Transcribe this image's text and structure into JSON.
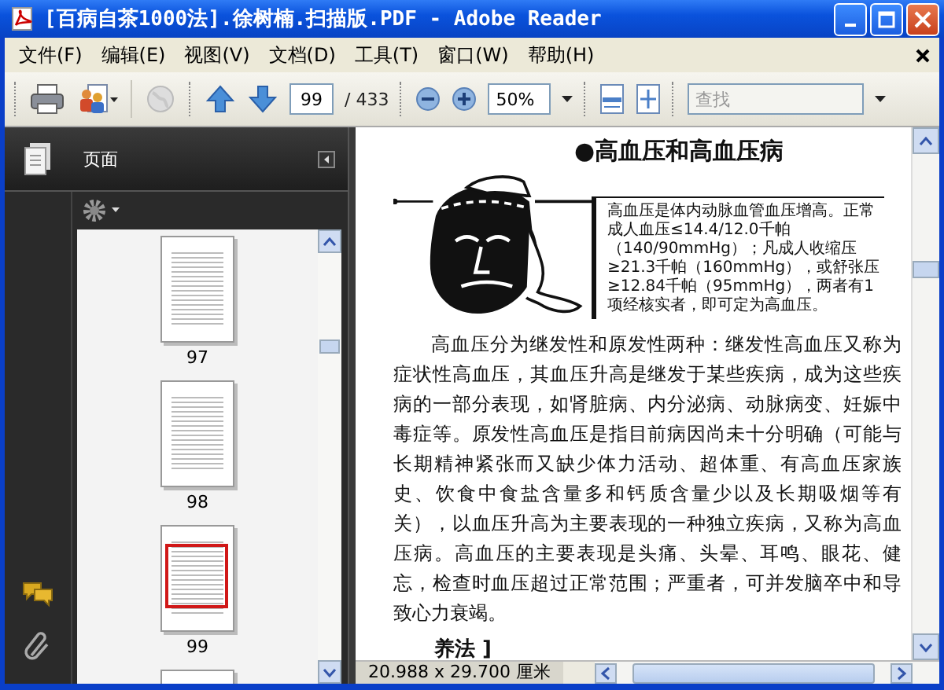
{
  "window": {
    "title": "[百病自茶1000法].徐树楠.扫描版.PDF - Adobe Reader"
  },
  "menu": [
    "文件(F)",
    "编辑(E)",
    "视图(V)",
    "文档(D)",
    "工具(T)",
    "窗口(W)",
    "帮助(H)"
  ],
  "toolbar": {
    "page_number": "99",
    "page_total": "/ 433",
    "zoom": "50%",
    "search": {
      "placeholder": "查找"
    }
  },
  "nav_panel": {
    "title": "页面",
    "thumbnails": [
      {
        "label": "97",
        "selected": false
      },
      {
        "label": "98",
        "selected": false
      },
      {
        "label": "99",
        "selected": true
      }
    ]
  },
  "document": {
    "heading": "●高血压和高血压病",
    "note": "高血压是体内动脉血管血压增高。正常成人血压≤14.4/12.0千帕（140/90mmHg）；凡成人收缩压≥21.3千帕（160mmHg），或舒张压≥12.84千帕（95mmHg），两者有1项经核实者，即可定为高血压。",
    "body": "高血压分为继发性和原发性两种：继发性高血压又称为症状性高血压，其血压升高是继发于某些疾病，成为这些疾病的一部分表现，如肾脏病、内分泌病、动脉病变、妊娠中毒症等。原发性高血压是指目前病因尚未十分明确（可能与长期精神紧张而又缺少体力活动、超体重、有高血压家族史、饮食中食盐含量多和钙质含量少以及长期吸烟等有关），以血压升高为主要表现的一种独立疾病，又称为高血压病。高血压的主要表现是头痛、头晕、耳鸣、眼花、健忘，检查时血压超过正常范围；严重者，可并发脑卒中和导致心力衰竭。",
    "subheading": "养法 ]"
  },
  "status_bar": {
    "page_size": "20.988 x 29.700 厘米"
  }
}
